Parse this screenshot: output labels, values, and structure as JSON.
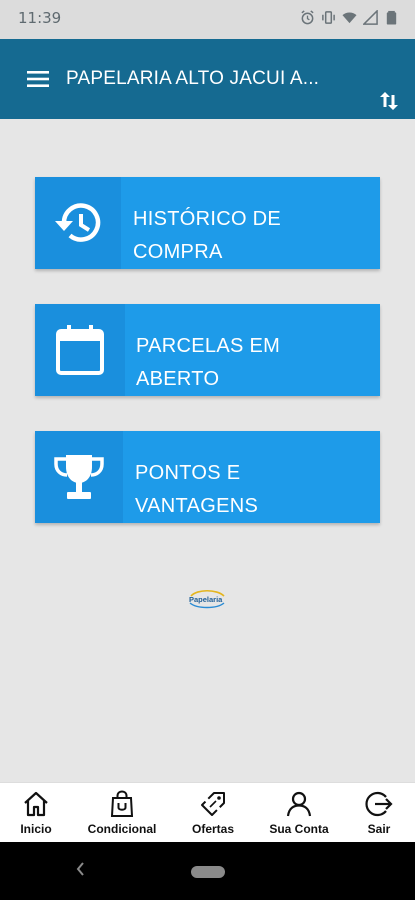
{
  "status_bar": {
    "time": "11:39",
    "icons": [
      "alarm-icon",
      "vibrate-icon",
      "wifi-icon",
      "signal-icon",
      "battery-icon"
    ]
  },
  "app_bar": {
    "title": "PAPELARIA ALTO JACUI A...",
    "color": "#156a91",
    "menu_icon": "menu-icon",
    "action_icon": "sort-icon"
  },
  "cards": [
    {
      "label_line1": "HISTÓRICO DE",
      "label_line2": "COMPRA",
      "icon": "history-icon"
    },
    {
      "label_line1": "PARCELAS EM",
      "label_line2": "ABERTO",
      "icon": "calendar-icon"
    },
    {
      "label_line1": "PONTOS E",
      "label_line2": "VANTAGENS",
      "icon": "trophy-icon"
    }
  ],
  "card_color": "#1e9be9",
  "logo": {
    "text": "Papelaria"
  },
  "bottom_nav": [
    {
      "label": "Inicio",
      "icon": "home-icon"
    },
    {
      "label": "Condicional",
      "icon": "shopping-bag-icon"
    },
    {
      "label": "Ofertas",
      "icon": "tag-icon"
    },
    {
      "label": "Sua Conta",
      "icon": "user-icon"
    },
    {
      "label": "Sair",
      "icon": "logout-icon"
    }
  ]
}
